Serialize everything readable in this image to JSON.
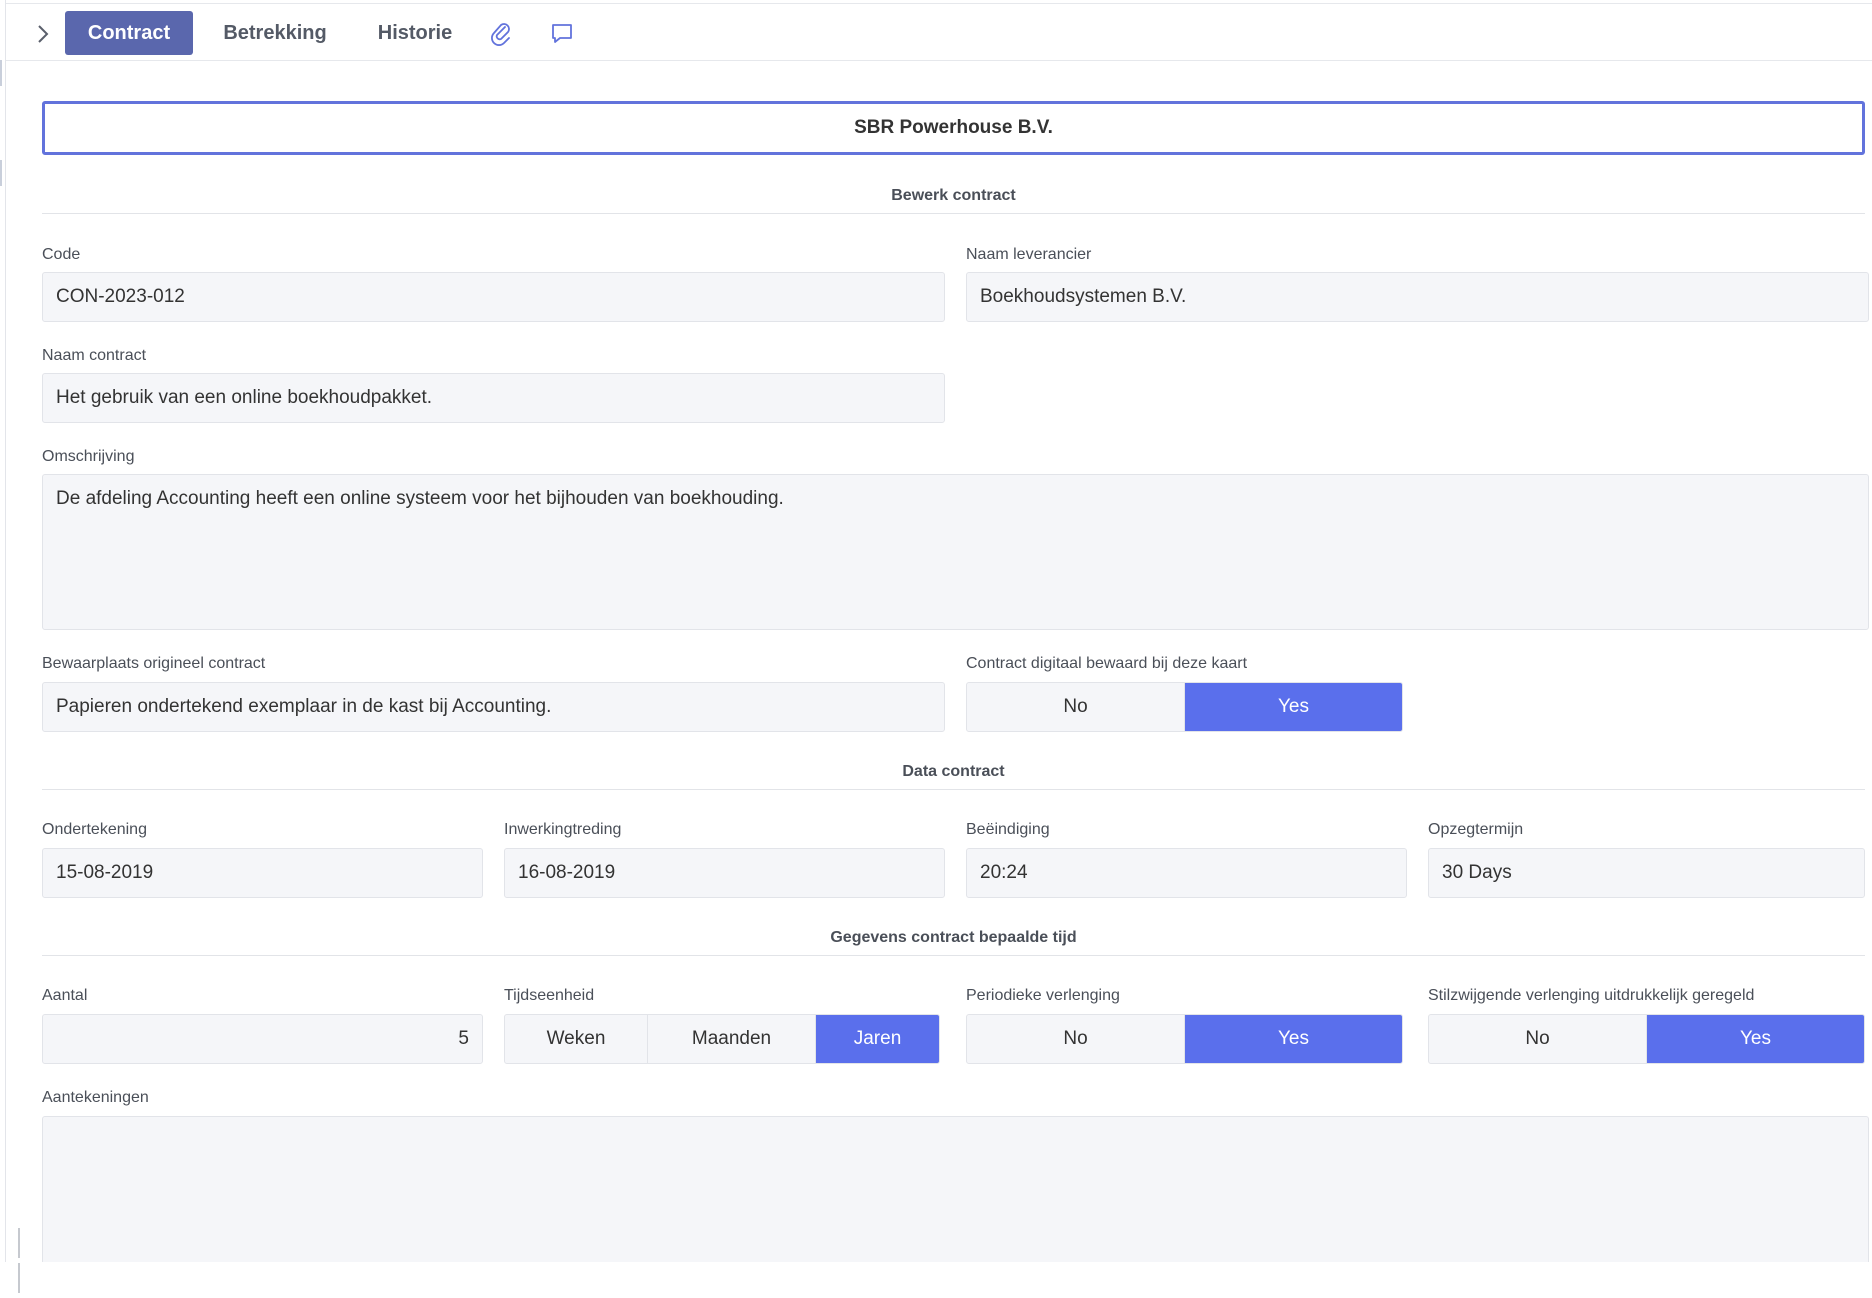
{
  "tabs": {
    "contract": "Contract",
    "betrekking": "Betrekking",
    "historie": "Historie"
  },
  "icons": {
    "expand": "chevron-right-icon",
    "attachment": "paperclip-icon",
    "comments": "speech-bubble-icon"
  },
  "header": {
    "title": "SBR Powerhouse B.V."
  },
  "sections": {
    "edit": "Bewerk contract",
    "dates": "Data contract",
    "fixed_term": "Gegevens contract bepaalde tijd"
  },
  "form": {
    "code": {
      "label": "Code",
      "value": "CON-2023-012"
    },
    "supplier": {
      "label": "Naam leverancier",
      "value": "Boekhoudsystemen B.V."
    },
    "name": {
      "label": "Naam contract",
      "value": "Het gebruik van een online boekhoudpakket."
    },
    "description": {
      "label": "Omschrijving",
      "value": "De afdeling Accounting heeft een online systeem voor het bijhouden van boekhouding."
    },
    "storage": {
      "label": "Bewaarplaats origineel contract",
      "value": "Papieren ondertekend exemplaar in de kast bij Accounting."
    },
    "digital": {
      "label": "Contract digitaal bewaard bij deze kaart",
      "no": "No",
      "yes": "Yes",
      "selected": "Yes"
    },
    "signing": {
      "label": "Ondertekening",
      "value": "15-08-2019"
    },
    "effective": {
      "label": "Inwerkingtreding",
      "value": "16-08-2019"
    },
    "termination": {
      "label": "Beëindiging",
      "value": "20:24"
    },
    "notice": {
      "label": "Opzegtermijn",
      "value": "30 Days"
    },
    "amount": {
      "label": "Aantal",
      "value": "5"
    },
    "time_unit": {
      "label": "Tijdseenheid",
      "weeks": "Weken",
      "months": "Maanden",
      "years": "Jaren",
      "selected": "Jaren"
    },
    "periodic": {
      "label": "Periodieke verlenging",
      "no": "No",
      "yes": "Yes",
      "selected": "Yes"
    },
    "tacit": {
      "label": "Stilzwijgende verlenging uitdrukkelijk geregeld",
      "no": "No",
      "yes": "Yes",
      "selected": "Yes"
    },
    "notes": {
      "label": "Aantekeningen",
      "value": ""
    }
  },
  "colors": {
    "tab_active": "#5a67ad",
    "toggle_active": "#5a6fec",
    "header_border": "#6273dc"
  }
}
